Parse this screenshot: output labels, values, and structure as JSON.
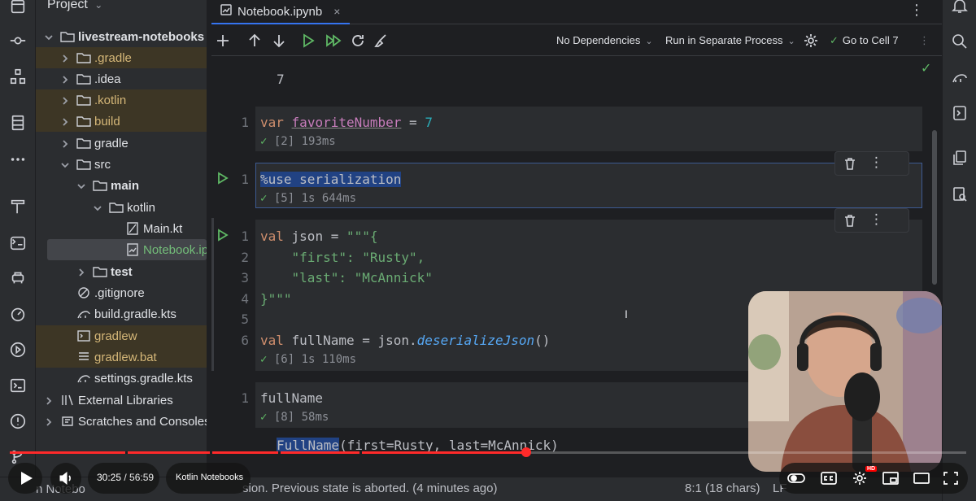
{
  "project_panel": {
    "title": "Project",
    "tree": [
      {
        "label": "livestream-notebooks",
        "icon": "folder-icon",
        "chevron": "down",
        "depth": 0,
        "style": "bold"
      },
      {
        "label": ".gradle",
        "icon": "folder-icon",
        "chevron": "right",
        "depth": 1,
        "style": "orange"
      },
      {
        "label": ".idea",
        "icon": "folder-icon",
        "chevron": "right",
        "depth": 1,
        "style": ""
      },
      {
        "label": ".kotlin",
        "icon": "folder-icon",
        "chevron": "right",
        "depth": 1,
        "style": "orange"
      },
      {
        "label": "build",
        "icon": "folder-icon",
        "chevron": "right",
        "depth": 1,
        "style": "orange"
      },
      {
        "label": "gradle",
        "icon": "folder-icon",
        "chevron": "right",
        "depth": 1,
        "style": ""
      },
      {
        "label": "src",
        "icon": "folder-icon",
        "chevron": "down",
        "depth": 1,
        "style": ""
      },
      {
        "label": "main",
        "icon": "folder-icon",
        "chevron": "down",
        "depth": 2,
        "style": "bold"
      },
      {
        "label": "kotlin",
        "icon": "folder-icon",
        "chevron": "down",
        "depth": 3,
        "style": ""
      },
      {
        "label": "Main.kt",
        "icon": "kotlin-file-icon",
        "chevron": "",
        "depth": 4,
        "style": ""
      },
      {
        "label": "Notebook.ipynb",
        "icon": "notebook-file-icon",
        "chevron": "",
        "depth": 4,
        "style": "green"
      },
      {
        "label": "test",
        "icon": "folder-icon",
        "chevron": "right",
        "depth": 2,
        "style": "bold"
      },
      {
        "label": ".gitignore",
        "icon": "ignore-file-icon",
        "chevron": "",
        "depth": 1,
        "style": ""
      },
      {
        "label": "build.gradle.kts",
        "icon": "gradle-file-icon",
        "chevron": "",
        "depth": 1,
        "style": ""
      },
      {
        "label": "gradlew",
        "icon": "terminal-file-icon",
        "chevron": "",
        "depth": 1,
        "style": "orange"
      },
      {
        "label": "gradlew.bat",
        "icon": "text-file-icon",
        "chevron": "",
        "depth": 1,
        "style": "orange"
      },
      {
        "label": "settings.gradle.kts",
        "icon": "gradle-file-icon",
        "chevron": "",
        "depth": 1,
        "style": ""
      },
      {
        "label": "External Libraries",
        "icon": "library-icon",
        "chevron": "right",
        "depth": 0,
        "style": ""
      },
      {
        "label": "Scratches and Consoles",
        "icon": "scratches-icon",
        "chevron": "right",
        "depth": 0,
        "style": ""
      }
    ]
  },
  "editor": {
    "tab_label": "Notebook.ipynb",
    "tab_close": "×",
    "toolbar": {
      "dependencies": "No Dependencies",
      "process": "Run in Separate Process",
      "goto": "Go to Cell 7"
    },
    "cells": [
      {
        "output_value": "7"
      },
      {
        "line_numbers": [
          "1"
        ],
        "status_ok": "✓",
        "status_text": " [2] 193ms"
      },
      {
        "line_numbers": [
          "1"
        ],
        "status_ok": "✓",
        "status_text": " [5] 1s 644ms"
      },
      {
        "line_numbers": [
          "1",
          "2",
          "3",
          "4",
          "5",
          "6"
        ],
        "status_ok": "✓",
        "status_text": " [6] 1s 110ms"
      },
      {
        "line_numbers": [
          "1"
        ],
        "code": "fullName",
        "status_ok": "✓",
        "status_text": " [8] 58ms"
      }
    ],
    "last_output": {
      "type_name": "FullName",
      "rest": "(first=Rusty, last=McAnnick)"
    }
  },
  "statusbar": {
    "left": "n Notebo",
    "message": "sion. Previous state is aborted. (4 minutes ago)",
    "position": "8:1 (18 chars)",
    "line_ending": "LF"
  },
  "video": {
    "progress": 0.54,
    "current_time": "30:25",
    "duration": "/ 56:59",
    "chapter": "Kotlin Notebooks",
    "hd_badge": "HD"
  },
  "colors": {
    "accent": "#3574f0",
    "run_green": "#5fb865",
    "progress_red": "#ff2a2a"
  }
}
